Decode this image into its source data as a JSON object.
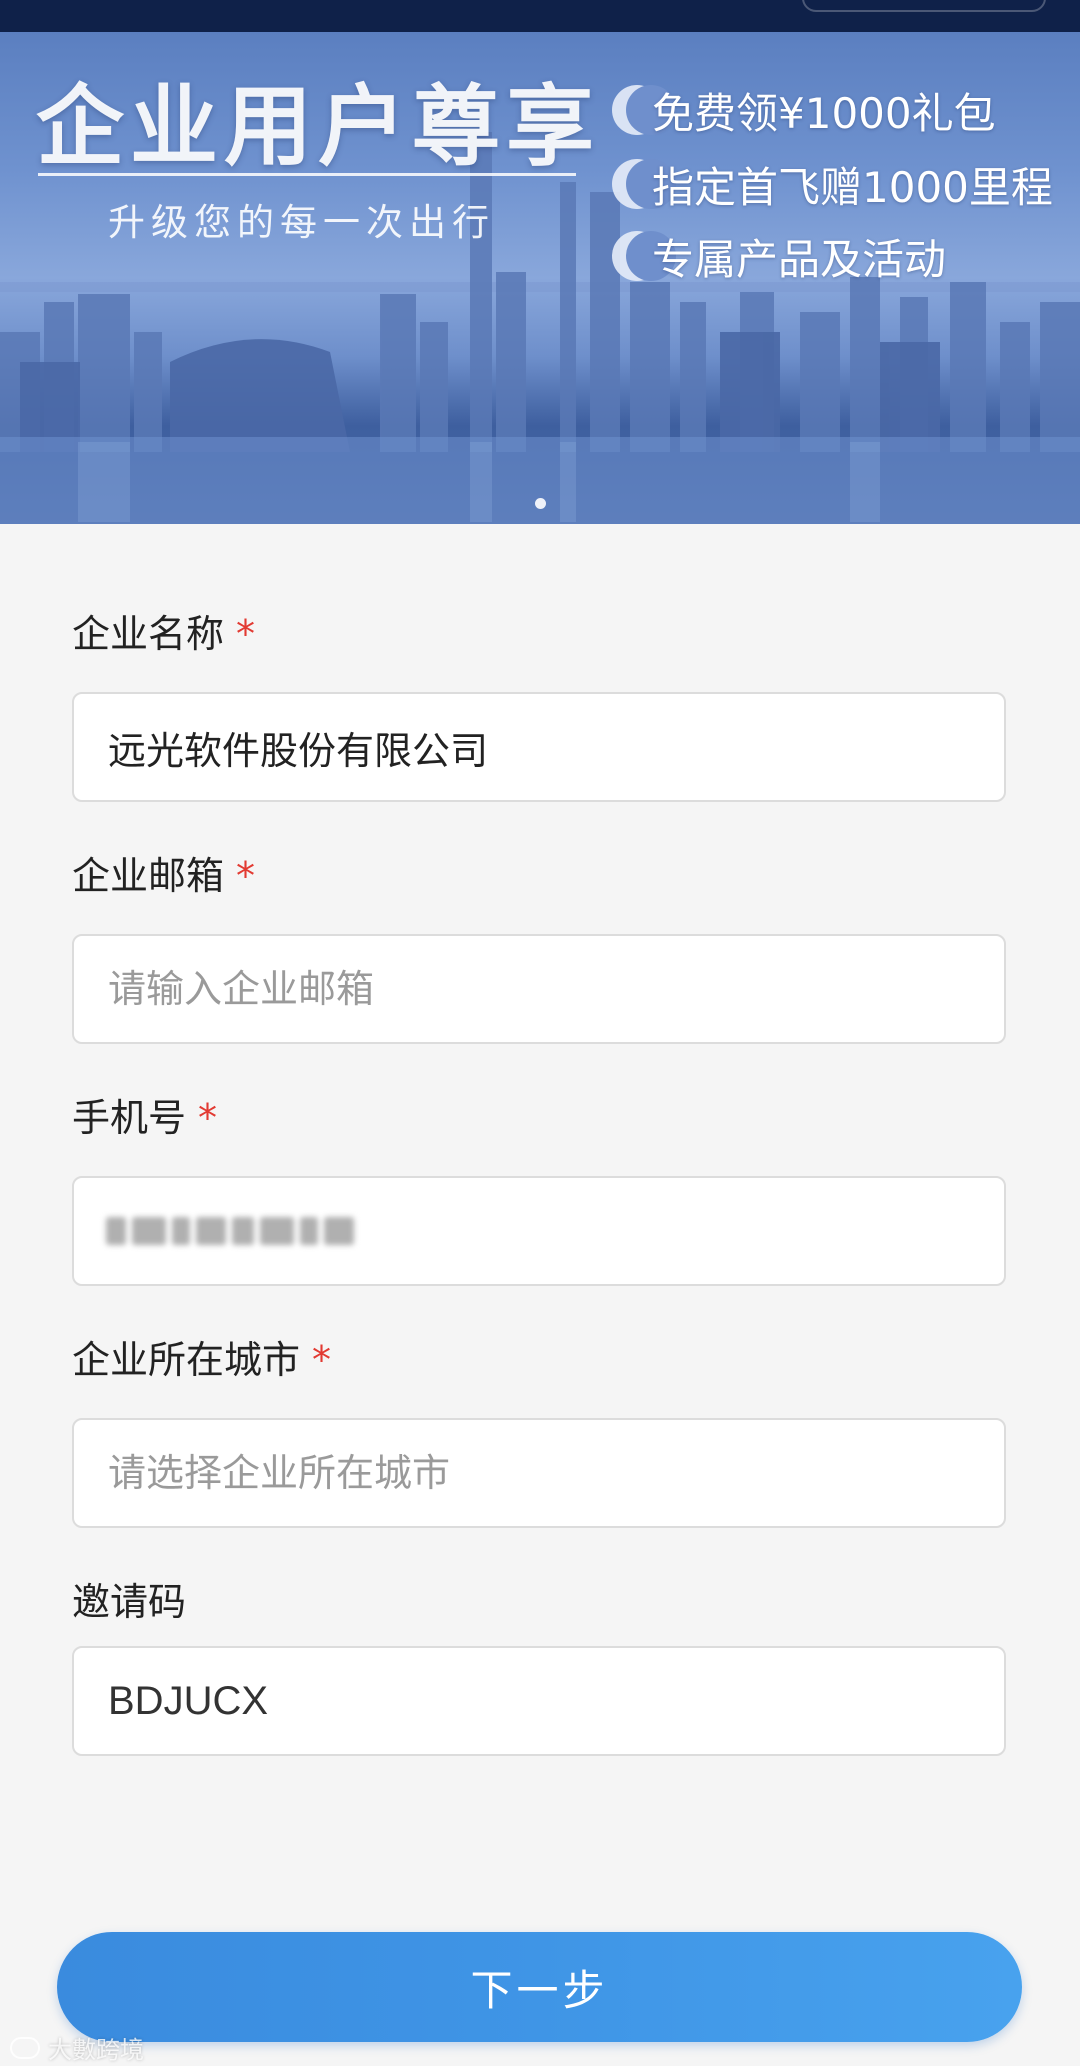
{
  "banner": {
    "title": "企业用户尊享",
    "subtitle": "升级您的每一次出行",
    "perks": [
      "免费领¥1000礼包",
      "指定首飞赠1000里程",
      "专属产品及活动"
    ],
    "carousel_active": 1,
    "carousel_count": 1
  },
  "form": {
    "company_name": {
      "label": "企业名称",
      "required_mark": "*",
      "value": "远光软件股份有限公司",
      "placeholder": ""
    },
    "company_email": {
      "label": "企业邮箱",
      "required_mark": "*",
      "value": "",
      "placeholder": "请输入企业邮箱"
    },
    "phone": {
      "label": "手机号",
      "required_mark": "*",
      "value_masked": true
    },
    "company_city": {
      "label": "企业所在城市",
      "required_mark": "*",
      "value": "",
      "placeholder": "请选择企业所在城市"
    },
    "invite_code": {
      "label": "邀请码",
      "value": "BDJUCX",
      "placeholder": ""
    }
  },
  "actions": {
    "next_label": "下一步"
  },
  "watermark": {
    "text": "大數跨境"
  },
  "colors": {
    "primary_button": "#3f95e6",
    "required": "#e23a32",
    "page_bg": "#f5f5f5",
    "topbar": "#0f2149"
  }
}
